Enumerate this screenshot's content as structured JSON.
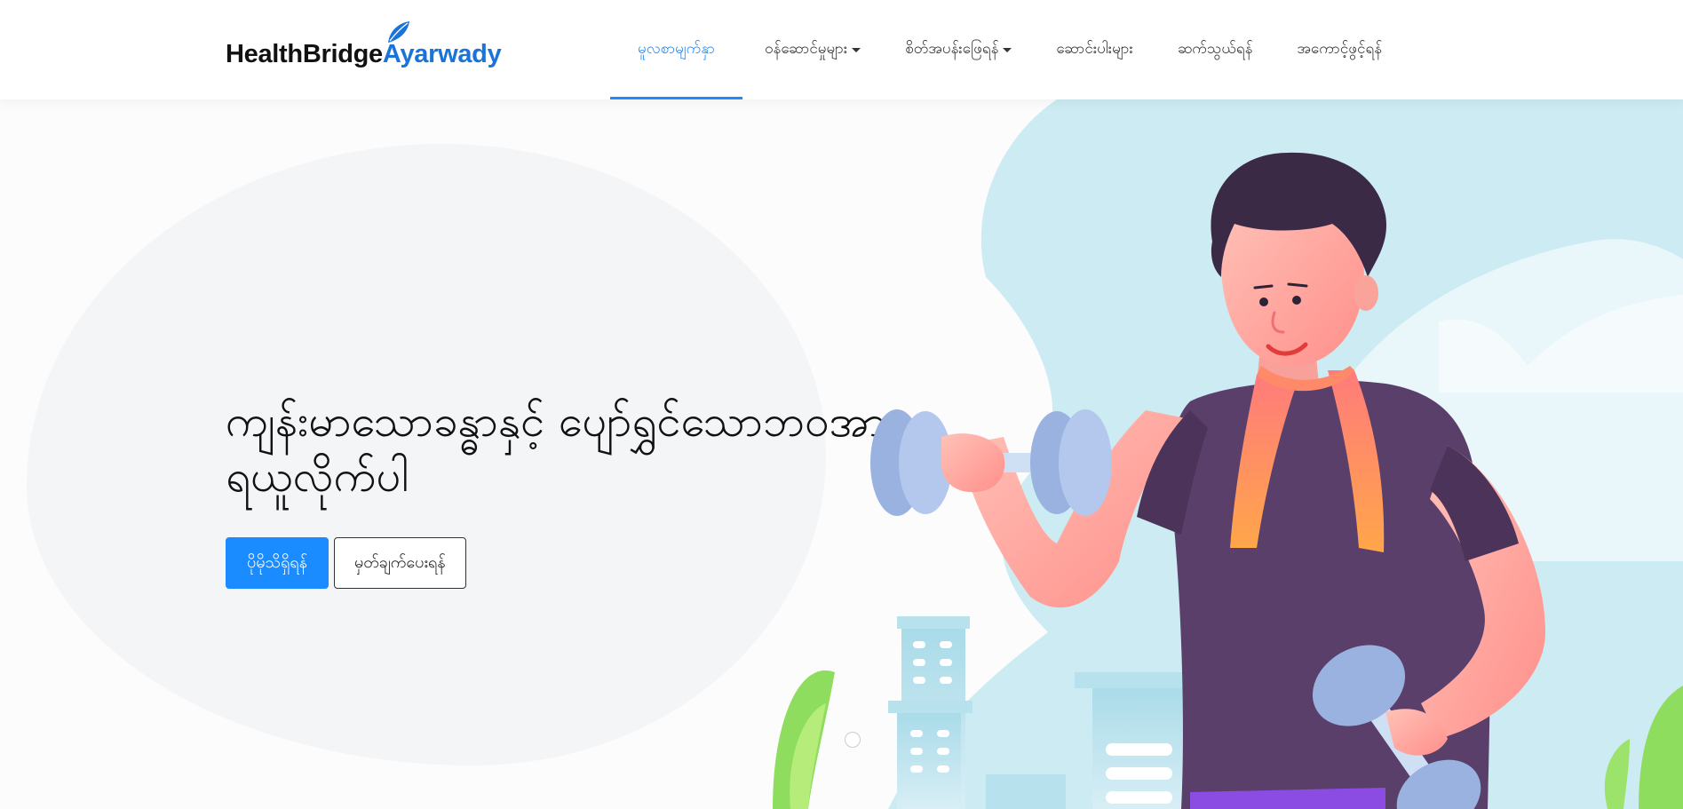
{
  "brand": {
    "name_part1": "HealthBridge",
    "name_part2": "Ayarwady",
    "primary_color": "#1a8cff",
    "logo_blue": "#1a73d9",
    "leaf_icon": "leaf-icon"
  },
  "nav": {
    "items": [
      {
        "label": "မူလစာမျက်နှာ",
        "active": true,
        "dropdown": false
      },
      {
        "label": "ဝန်ဆောင်မှုများ",
        "active": false,
        "dropdown": true
      },
      {
        "label": "စိတ်အပန်းဖြေရန်",
        "active": false,
        "dropdown": true
      },
      {
        "label": "ဆောင်းပါးများ",
        "active": false,
        "dropdown": false
      },
      {
        "label": "ဆက်သွယ်ရန်",
        "active": false,
        "dropdown": false
      },
      {
        "label": "အကောင့်ဖွင့်ရန်",
        "active": false,
        "dropdown": false
      }
    ]
  },
  "hero": {
    "title": "ကျန်းမာသောခန္ဓာနှင့် ပျော်ရွှင်သောဘဝအား ရယူလိုက်ပါ",
    "primary_button": "ပိုမိုသိရှိရန်",
    "secondary_button": "မှတ်ချက်ပေးရန်",
    "illustration": "man-lifting-dumbbells-illustration"
  }
}
